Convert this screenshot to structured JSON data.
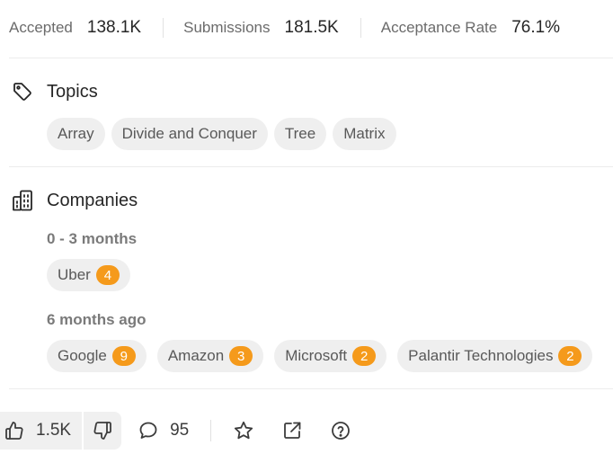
{
  "stats": {
    "accepted_label": "Accepted",
    "accepted_value": "138.1K",
    "submissions_label": "Submissions",
    "submissions_value": "181.5K",
    "acceptance_rate_label": "Acceptance Rate",
    "acceptance_rate_value": "76.1%"
  },
  "topics": {
    "title": "Topics",
    "icon": "tag-icon",
    "items": [
      "Array",
      "Divide and Conquer",
      "Tree",
      "Matrix"
    ]
  },
  "companies": {
    "title": "Companies",
    "icon": "buildings-icon",
    "groups": [
      {
        "period": "0 - 3 months",
        "items": [
          {
            "name": "Uber",
            "count": "4"
          }
        ]
      },
      {
        "period": "6 months ago",
        "items": [
          {
            "name": "Google",
            "count": "9"
          },
          {
            "name": "Amazon",
            "count": "3"
          },
          {
            "name": "Microsoft",
            "count": "2"
          },
          {
            "name": "Palantir Technologies",
            "count": "2"
          }
        ]
      }
    ]
  },
  "actions": {
    "likes": "1.5K",
    "comments": "95",
    "icons": [
      "thumbs-up-icon",
      "thumbs-down-icon",
      "comment-icon",
      "star-icon",
      "external-link-icon",
      "help-icon"
    ]
  },
  "colors": {
    "badge": "#f59a1b",
    "chip_bg": "#efefef",
    "divider": "#ececec"
  }
}
